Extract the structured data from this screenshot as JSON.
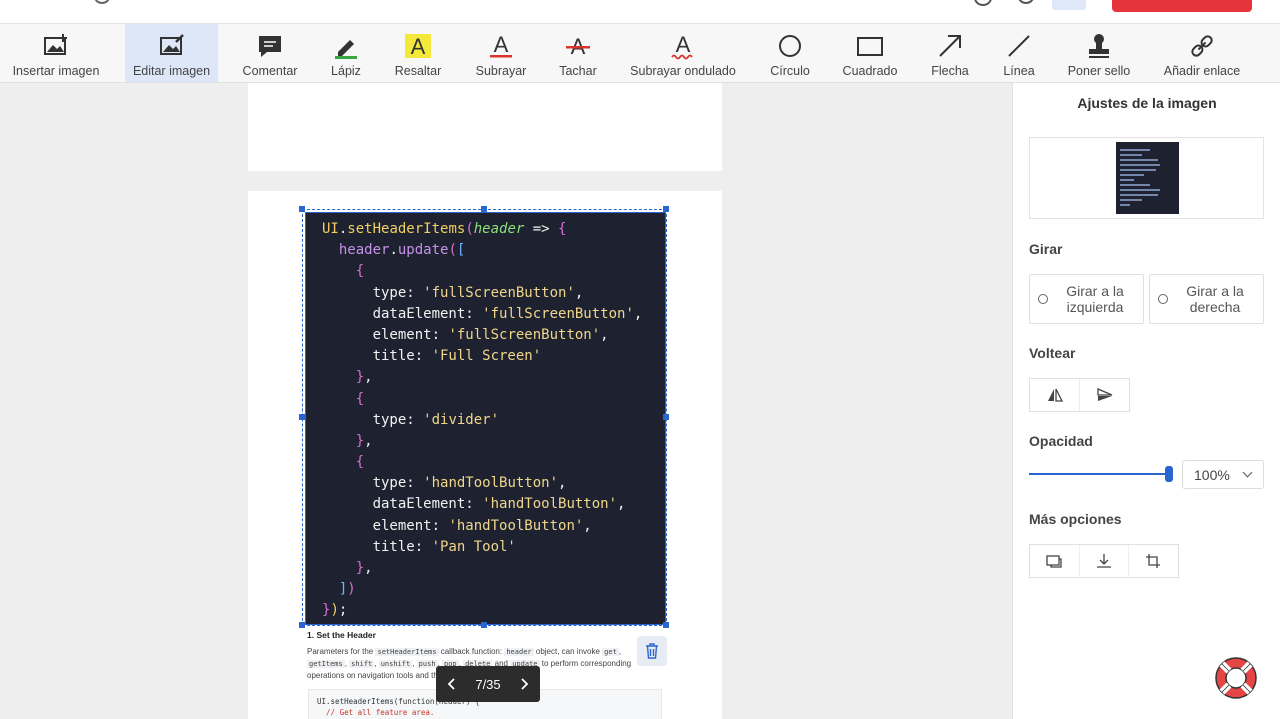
{
  "toolbar": {
    "tools": [
      {
        "label": "Insertar imagen",
        "icon": "insert-image-icon"
      },
      {
        "label": "Editar imagen",
        "icon": "edit-image-icon",
        "active": true
      },
      {
        "label": "Comentar",
        "icon": "comment-icon"
      },
      {
        "label": "Lápiz",
        "icon": "pencil-icon"
      },
      {
        "label": "Resaltar",
        "icon": "highlight-icon"
      },
      {
        "label": "Subrayar",
        "icon": "underline-icon"
      },
      {
        "label": "Tachar",
        "icon": "strikethrough-icon"
      },
      {
        "label": "Subrayar ondulado",
        "icon": "squiggly-icon"
      },
      {
        "label": "Círculo",
        "icon": "circle-icon"
      },
      {
        "label": "Cuadrado",
        "icon": "square-icon"
      },
      {
        "label": "Flecha",
        "icon": "arrow-icon"
      },
      {
        "label": "Línea",
        "icon": "line-icon"
      },
      {
        "label": "Poner sello",
        "icon": "stamp-icon"
      },
      {
        "label": "Añadir enlace",
        "icon": "link-icon"
      }
    ]
  },
  "document": {
    "code_image": {
      "lines": [
        "UI.setHeaderItems(header => {",
        "  header.update([",
        "    {",
        "      type: 'fullScreenButton',",
        "      dataElement: 'fullScreenButton',",
        "      element: 'fullScreenButton',",
        "      title: 'Full Screen'",
        "    },",
        "    {",
        "      type: 'divider'",
        "    },",
        "    {",
        "      type: 'handToolButton',",
        "      dataElement: 'handToolButton',",
        "      element: 'handToolButton',",
        "      title: 'Pan Tool'",
        "    },",
        "  ])",
        "});"
      ]
    },
    "section_heading": "1. Set the Header",
    "paragraph": {
      "p1": "Parameters for the",
      "code1": "setHeaderItems",
      "p2": "callback function:",
      "code2": "header",
      "p3": "object, can invoke",
      "code3": "get",
      "code4": "getItems",
      "code5": "shift",
      "code6": "unshift",
      "code7": "push",
      "code8": "pop",
      "code9": "delete",
      "p4": "and",
      "code10": "update",
      "p5": "to perform corresponding operations on navigation tools and the header."
    },
    "snippet": {
      "line1": "UI.setHeaderItems(function(header) {",
      "line2": "  // Get all feature area."
    },
    "pager": {
      "current_total": "7/35"
    }
  },
  "panel": {
    "title": "Ajustes de la imagen",
    "rotate": {
      "heading": "Girar",
      "left": "Girar a la izquierda",
      "right": "Girar a la derecha"
    },
    "flip": {
      "heading": "Voltear"
    },
    "opacity": {
      "heading": "Opacidad",
      "value": "100%",
      "level": 1.0
    },
    "more": {
      "heading": "Más opciones"
    }
  },
  "colors": {
    "accent": "#2b66d0",
    "brand_red": "#e5343c",
    "code_bg": "#1e2230"
  }
}
